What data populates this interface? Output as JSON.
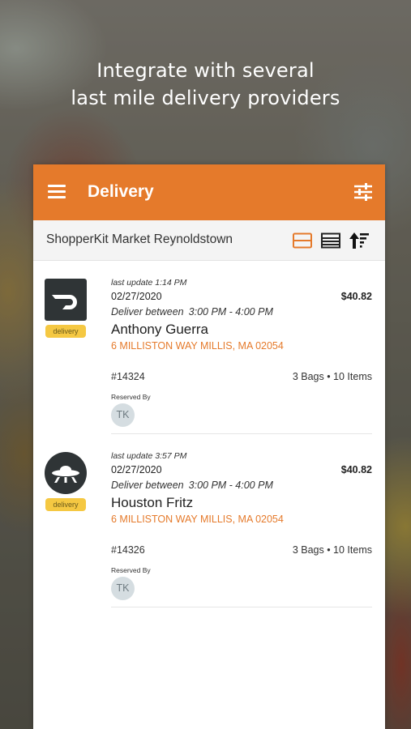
{
  "headline": {
    "line1": "Integrate with several",
    "line2": "last mile delivery providers"
  },
  "appbar": {
    "title": "Delivery",
    "menu_icon": "hamburger-menu-icon",
    "filter_icon": "sliders-icon",
    "color": "#e57a2b"
  },
  "storebar": {
    "store_name": "ShopperKit Market Reynoldstown",
    "card_view_icon": "card-view-icon",
    "list_view_icon": "list-view-icon",
    "sort_icon": "sort-icon"
  },
  "orders": [
    {
      "provider_icon": "doordash-logo-icon",
      "badge": "delivery",
      "last_update": "last update 1:14 PM",
      "date": "02/27/2020",
      "price": "$40.82",
      "window_label": "Deliver between",
      "window_time": "3:00 PM - 4:00 PM",
      "customer": "Anthony Guerra",
      "address": "6 MILLISTON WAY  MILLIS, MA 02054",
      "order_number": "#14324",
      "bags_items": "3 Bags • 10 Items",
      "reserved_by_label": "Reserved By",
      "reserved_initials": "TK"
    },
    {
      "provider_icon": "ufo-logo-icon",
      "badge": "delivery",
      "last_update": "last update 3:57 PM",
      "date": "02/27/2020",
      "price": "$40.82",
      "window_label": "Deliver between",
      "window_time": "3:00 PM - 4:00 PM",
      "customer": "Houston Fritz",
      "address": "6 MILLISTON WAY  MILLIS, MA 02054",
      "order_number": "#14326",
      "bags_items": "3 Bags • 10 Items",
      "reserved_by_label": "Reserved By",
      "reserved_initials": "TK"
    }
  ]
}
